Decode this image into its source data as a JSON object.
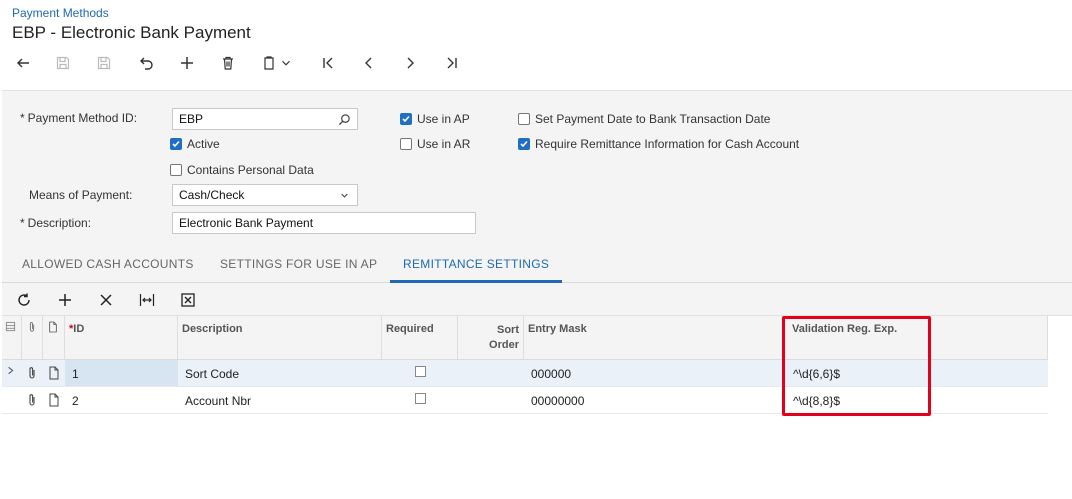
{
  "breadcrumb": "Payment Methods",
  "title": "EBP - Electronic Bank Payment",
  "form": {
    "payment_method_id_label": "Payment Method ID:",
    "payment_method_id_value": "EBP",
    "active_label": "Active",
    "active_checked": true,
    "contains_personal_data_label": "Contains Personal Data",
    "contains_personal_data_checked": false,
    "means_of_payment_label": "Means of Payment:",
    "means_of_payment_value": "Cash/Check",
    "description_label": "Description:",
    "description_value": "Electronic Bank Payment",
    "use_in_ap_label": "Use in AP",
    "use_in_ap_checked": true,
    "use_in_ar_label": "Use in AR",
    "use_in_ar_checked": false,
    "set_payment_date_label": "Set Payment Date to Bank Transaction Date",
    "set_payment_date_checked": false,
    "require_remittance_label": "Require Remittance Information for Cash Account",
    "require_remittance_checked": true,
    "required_marker": "*"
  },
  "tabs": [
    "ALLOWED CASH ACCOUNTS",
    "SETTINGS FOR USE IN AP",
    "REMITTANCE SETTINGS"
  ],
  "active_tab": "REMITTANCE SETTINGS",
  "grid": {
    "columns": {
      "id": "ID",
      "description": "Description",
      "required": "Required",
      "sort_order_line1": "Sort",
      "sort_order_line2": "Order",
      "entry_mask": "Entry Mask",
      "validation": "Validation Reg. Exp."
    },
    "rows": [
      {
        "id": "1",
        "description": "Sort Code",
        "required": false,
        "entry_mask": "000000",
        "validation": "^\\d{6,6}$"
      },
      {
        "id": "2",
        "description": "Account Nbr",
        "required": false,
        "entry_mask": "00000000",
        "validation": "^\\d{8,8}$"
      }
    ]
  },
  "colors": {
    "accent": "#1e6ab0",
    "checkbox": "#1f6fc5",
    "highlight": "#e3001b"
  }
}
